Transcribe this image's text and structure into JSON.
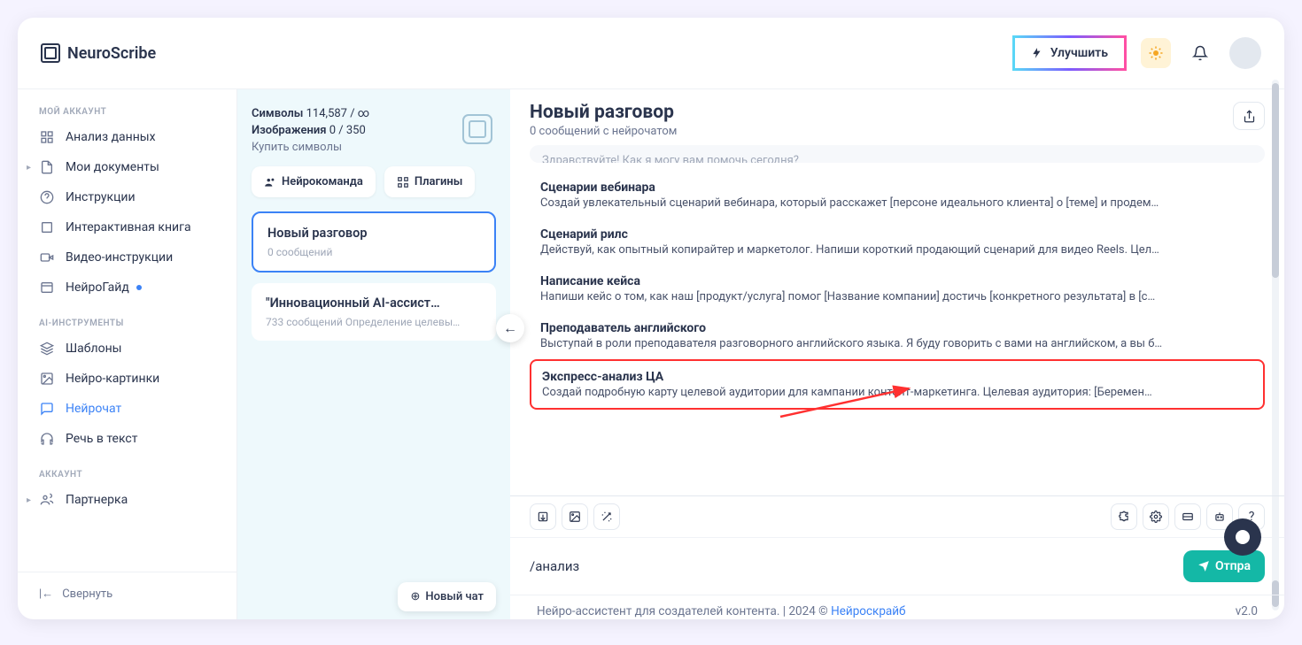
{
  "brand": {
    "name": "NeuroScribe"
  },
  "header": {
    "improve_label": "Улучшить"
  },
  "sidebar": {
    "sections": {
      "account": "МОЙ АККАУНТ",
      "ai_tools": "AI-ИНСТРУМЕНТЫ",
      "account2": "АККАУНТ"
    },
    "items": {
      "analytics": "Анализ данных",
      "documents": "Мои документы",
      "instructions": "Инструкции",
      "interactive_book": "Интерактивная книга",
      "video_instructions": "Видео-инструкции",
      "neuroguide": "НейроГайд",
      "templates": "Шаблоны",
      "neuro_images": "Нейро-картинки",
      "neurochat": "Нейрочат",
      "speech_to_text": "Речь в текст",
      "partner": "Партнерка"
    },
    "collapse": "Свернуть"
  },
  "chatlist": {
    "symbols_label": "Символы",
    "symbols_value": "114,587 / ∞",
    "images_label": "Изображения",
    "images_value": "0 / 350",
    "buy": "Купить символы",
    "team_chip": "Нейрокоманда",
    "plugins_chip": "Плагины",
    "conversations": [
      {
        "title": "Новый разговор",
        "sub": "0 сообщений"
      },
      {
        "title": "\"Инновационный AI-ассист…",
        "sub": "733 сообщений Определение целевы…"
      }
    ],
    "new_chat": "Новый чат"
  },
  "main": {
    "title": "Новый разговор",
    "subtitle": "0 сообщений с нейрочатом",
    "greeting_clipped": "Здравствуйте! Как я могу вам помочь сегодня?",
    "templates": [
      {
        "title": "Сценарии вебинара",
        "desc": "Создай увлекательный сценарий вебинара, который расскажет [персоне идеального клиента] о [теме] и продем…"
      },
      {
        "title": "Сценарий рилс",
        "desc": "Действуй, как опытный копирайтер и маркетолог. Напиши короткий продающий сценарий для видео Reels. Цел…"
      },
      {
        "title": "Написание кейса",
        "desc": "Напиши кейс о том, как наш [продукт/услуга] помог [Название компании] достичь [конкретного результата] в [с…"
      },
      {
        "title": "Преподаватель английского",
        "desc": "Выступай в роли преподавателя разговорного английского языка. Я буду говорить с вами на английском, а вы б…"
      },
      {
        "title": "Экспресс-анализ ЦА",
        "desc": "Создай подробную карту целевой аудитории для кампании контент-маркетинга. Целевая аудитория: [Беремен…"
      }
    ],
    "input_value": "/анализ",
    "send_label": "Отпра"
  },
  "footer": {
    "text_before": "Нейро-ассистент для создателей контента.  | 2024 © ",
    "link": "Нейроскрайб",
    "version": "v2.0"
  }
}
